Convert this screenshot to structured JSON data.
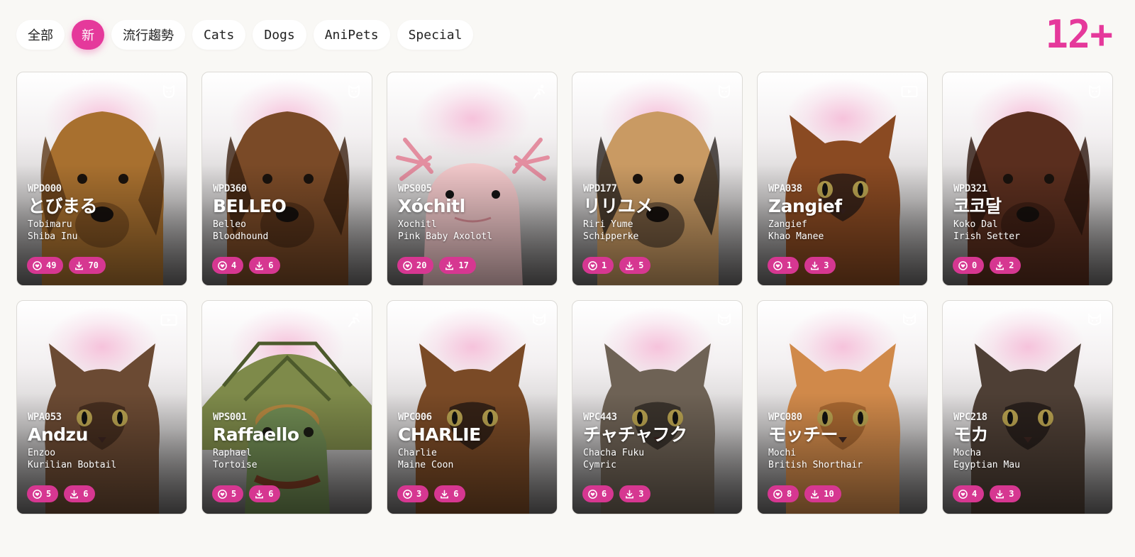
{
  "tabs": [
    {
      "label": "全部",
      "active": false
    },
    {
      "label": "新",
      "active": true
    },
    {
      "label": "流行趨勢",
      "active": false
    },
    {
      "label": "Cats",
      "active": false
    },
    {
      "label": "Dogs",
      "active": false
    },
    {
      "label": "AniPets",
      "active": false
    },
    {
      "label": "Special",
      "active": false
    }
  ],
  "age_rating": "12+",
  "colors": {
    "accent": "#e5399b",
    "pill": "#d63791",
    "background": "#f9f8f5"
  },
  "cards": [
    {
      "code": "WPD000",
      "name": "とびまる",
      "romaji": "Tobimaru",
      "breed": "Shiba Inu",
      "likes": "49",
      "downloads": "70",
      "type_icon": "dog-icon",
      "fur": "#a8702f",
      "fur_dark": "#5e3a18",
      "kind": "dog"
    },
    {
      "code": "WPD360",
      "name": "BELLEO",
      "romaji": "Belleo",
      "breed": "Bloodhound",
      "likes": "4",
      "downloads": "6",
      "type_icon": "dog-icon",
      "fur": "#7a4a27",
      "fur_dark": "#3b2010",
      "kind": "dog"
    },
    {
      "code": "WPS005",
      "name": "Xóchitl",
      "romaji": "Xochitl",
      "breed": "Pink Baby Axolotl",
      "likes": "20",
      "downloads": "17",
      "type_icon": "special-icon",
      "fur": "#f1c7c9",
      "fur_dark": "#d98c95",
      "kind": "axolotl"
    },
    {
      "code": "WPD177",
      "name": "リリユメ",
      "romaji": "Riri Yume",
      "breed": "Schipperke",
      "likes": "1",
      "downloads": "5",
      "type_icon": "dog-icon",
      "fur": "#c99a63",
      "fur_dark": "#2b2421",
      "kind": "dog"
    },
    {
      "code": "WPA038",
      "name": "Zangief",
      "romaji": "Zangief",
      "breed": "Khao Manee",
      "likes": "1",
      "downloads": "3",
      "type_icon": "anipet-icon",
      "fur": "#8a4a22",
      "fur_dark": "#211815",
      "kind": "cat"
    },
    {
      "code": "WPD321",
      "name": "코코달",
      "romaji": "Koko Dal",
      "breed": "Irish Setter",
      "likes": "0",
      "downloads": "2",
      "type_icon": "dog-icon",
      "fur": "#5a2e1e",
      "fur_dark": "#2d160e",
      "kind": "dog"
    },
    {
      "code": "WPA053",
      "name": "Andzu",
      "romaji": "Enzoo",
      "breed": "Kurilian Bobtail",
      "likes": "5",
      "downloads": "6",
      "type_icon": "anipet-icon",
      "fur": "#6b4a33",
      "fur_dark": "#3a2619",
      "kind": "cat"
    },
    {
      "code": "WPS001",
      "name": "Raffaello",
      "romaji": "Raphael",
      "breed": "Tortoise",
      "likes": "5",
      "downloads": "6",
      "type_icon": "special-icon",
      "fur": "#6f8a52",
      "fur_dark": "#7a3a22",
      "kind": "tortoise"
    },
    {
      "code": "WPC006",
      "name": "CHARLIE",
      "romaji": "Charlie",
      "breed": "Maine Coon",
      "likes": "3",
      "downloads": "6",
      "type_icon": "cat-icon",
      "fur": "#7a4a26",
      "fur_dark": "#1f1512",
      "kind": "cat"
    },
    {
      "code": "WPC443",
      "name": "チャチャフク",
      "romaji": "Chacha Fuku",
      "breed": "Cymric",
      "likes": "6",
      "downloads": "3",
      "type_icon": "cat-icon",
      "fur": "#6e6255",
      "fur_dark": "#2a241f",
      "kind": "cat"
    },
    {
      "code": "WPC080",
      "name": "モッチー",
      "romaji": "Mochi",
      "breed": "British Shorthair",
      "likes": "8",
      "downloads": "10",
      "type_icon": "cat-icon",
      "fur": "#d0894a",
      "fur_dark": "#9a5c2a",
      "kind": "cat"
    },
    {
      "code": "WPC218",
      "name": "モカ",
      "romaji": "Mocha",
      "breed": "Egyptian Mau",
      "likes": "4",
      "downloads": "3",
      "type_icon": "cat-icon",
      "fur": "#4e3f35",
      "fur_dark": "#1e1714",
      "kind": "cat"
    }
  ]
}
